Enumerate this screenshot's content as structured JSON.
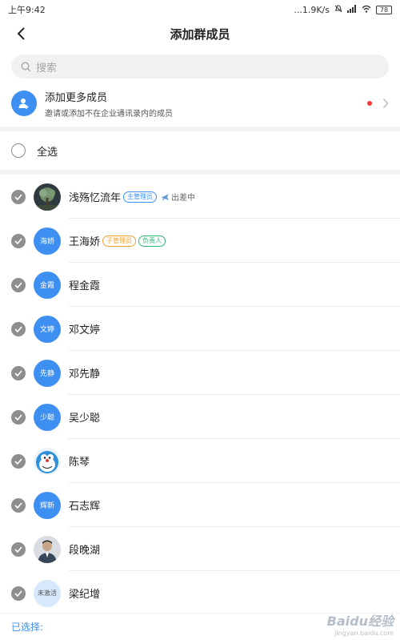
{
  "status_bar": {
    "time": "上午9:42",
    "net_speed": "...1.9K/s",
    "battery": "78"
  },
  "header": {
    "title": "添加群成员",
    "back_icon": "chevron-left-icon"
  },
  "search": {
    "placeholder": "搜索",
    "icon": "search-icon"
  },
  "add_more": {
    "title": "添加更多成员",
    "subtitle": "邀请或添加不在企业通讯录内的成员",
    "icon": "add-user-icon"
  },
  "select_all": {
    "label": "全选"
  },
  "members": [
    {
      "name": "浅殇忆流年",
      "avatar_text": "",
      "avatar_kind": "photo-tree",
      "checked": true,
      "tags": [
        "主管理员"
      ],
      "status": "出差中"
    },
    {
      "name": "王海娇",
      "avatar_text": "海娇",
      "avatar_kind": "text",
      "checked": true,
      "tags": [
        "子管理员",
        "负责人"
      ],
      "status": ""
    },
    {
      "name": "程金霞",
      "avatar_text": "金霞",
      "avatar_kind": "text",
      "checked": true,
      "tags": [],
      "status": ""
    },
    {
      "name": "邓文婷",
      "avatar_text": "文婷",
      "avatar_kind": "text",
      "checked": true,
      "tags": [],
      "status": ""
    },
    {
      "name": "邓先静",
      "avatar_text": "先静",
      "avatar_kind": "text",
      "checked": true,
      "tags": [],
      "status": ""
    },
    {
      "name": "吴少聪",
      "avatar_text": "少聪",
      "avatar_kind": "text",
      "checked": true,
      "tags": [],
      "status": ""
    },
    {
      "name": "陈琴",
      "avatar_text": "",
      "avatar_kind": "photo-cartoon",
      "checked": true,
      "tags": [],
      "status": ""
    },
    {
      "name": "石志辉",
      "avatar_text": "辉新",
      "avatar_kind": "text",
      "checked": true,
      "tags": [],
      "status": ""
    },
    {
      "name": "段晚湖",
      "avatar_text": "",
      "avatar_kind": "photo-person",
      "checked": true,
      "tags": [],
      "status": ""
    },
    {
      "name": "梁纪增",
      "avatar_text": "未激活",
      "avatar_kind": "pale",
      "checked": true,
      "tags": [],
      "status": ""
    }
  ],
  "bottom": {
    "selected_label": "已选择:"
  },
  "watermark": {
    "main": "Baidu经验",
    "sub": "jingyan.baidu.com"
  },
  "colors": {
    "accent": "#3d8ff2",
    "check_gray": "#8e8e8e",
    "red_dot": "#f03b3b",
    "tag_orange": "#f0a030",
    "tag_green": "#2bb673"
  }
}
